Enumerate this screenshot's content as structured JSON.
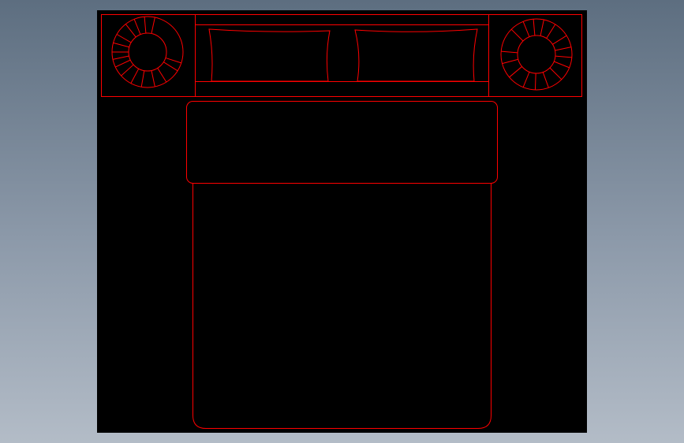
{
  "drawing": {
    "background_color": "#000000",
    "line_color": "#ff0000",
    "canvas_gradient": [
      "#5d6e80",
      "#b3bcc7"
    ],
    "icons": {
      "left_lamp": "lamp-icon",
      "right_lamp": "lamp-icon"
    }
  }
}
